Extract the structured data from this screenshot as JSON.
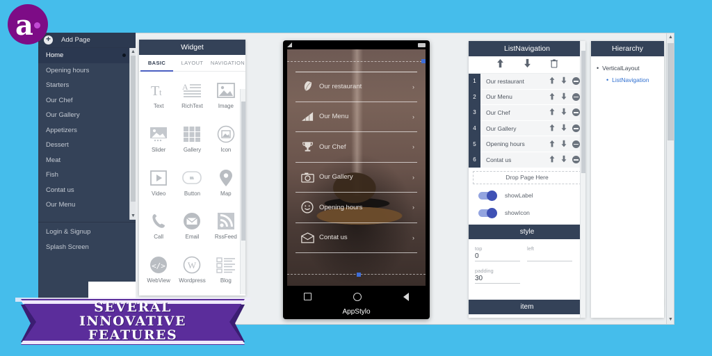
{
  "brand": {
    "logo_letter": "a",
    "logo_color": "#7d0c86"
  },
  "theme": {
    "background": "#45bdeb",
    "panel_header": "#344258",
    "sidebar": "#344258",
    "accent_blue": "#4662c6",
    "ribbon_purple": "#5b2d9b"
  },
  "sidebar": {
    "add_page_label": "Add Page",
    "items": [
      {
        "label": "Home",
        "active": true
      },
      {
        "label": "Opening hours",
        "active": false
      },
      {
        "label": "Starters",
        "active": false
      },
      {
        "label": "Our Chef",
        "active": false
      },
      {
        "label": "Our Gallery",
        "active": false
      },
      {
        "label": "Appetizers",
        "active": false
      },
      {
        "label": "Dessert",
        "active": false
      },
      {
        "label": "Meat",
        "active": false
      },
      {
        "label": "Fish",
        "active": false
      },
      {
        "label": "Contat us",
        "active": false
      },
      {
        "label": "Our Menu",
        "active": false
      }
    ],
    "footer_items": [
      {
        "label": "Login & Signup"
      },
      {
        "label": "Splash Screen"
      }
    ]
  },
  "widget_panel": {
    "title": "Widget",
    "tabs": [
      {
        "label": "BASIC",
        "active": true
      },
      {
        "label": "LAYOUT",
        "active": false
      },
      {
        "label": "NAVIGATION",
        "active": false
      }
    ],
    "widgets": [
      {
        "label": "Text",
        "icon": "text-icon"
      },
      {
        "label": "RichText",
        "icon": "richtext-icon"
      },
      {
        "label": "Image",
        "icon": "image-icon"
      },
      {
        "label": "Slider",
        "icon": "slider-icon"
      },
      {
        "label": "Gallery",
        "icon": "gallery-icon"
      },
      {
        "label": "Icon",
        "icon": "icon-icon"
      },
      {
        "label": "Video",
        "icon": "video-icon"
      },
      {
        "label": "Button",
        "icon": "button-icon"
      },
      {
        "label": "Map",
        "icon": "map-pin-icon"
      },
      {
        "label": "Call",
        "icon": "phone-icon"
      },
      {
        "label": "Email",
        "icon": "envelope-icon"
      },
      {
        "label": "RssFeed",
        "icon": "rss-icon"
      },
      {
        "label": "WebView",
        "icon": "code-icon"
      },
      {
        "label": "Wordpress",
        "icon": "wordpress-icon"
      },
      {
        "label": "Blog",
        "icon": "blog-icon"
      }
    ]
  },
  "phone": {
    "brand_label": "AppStylo",
    "rows": [
      {
        "label": "Our restaurant",
        "icon": "leaf-icon",
        "chevron": "›"
      },
      {
        "label": "Our Menu",
        "icon": "signal-bars-icon",
        "chevron": "›"
      },
      {
        "label": "Our Chef",
        "icon": "trophy-icon",
        "chevron": "›"
      },
      {
        "label": "Our Gallery",
        "icon": "camera-icon",
        "chevron": "›"
      },
      {
        "label": "Opening hours",
        "icon": "smiley-icon",
        "chevron": "›"
      },
      {
        "label": "Contat us",
        "icon": "mail-open-icon",
        "chevron": "›"
      }
    ]
  },
  "list_navigation": {
    "title": "ListNavigation",
    "toolbar": [
      {
        "icon": "move-up-icon"
      },
      {
        "icon": "move-down-icon"
      },
      {
        "icon": "trash-icon"
      }
    ],
    "rows": [
      {
        "num": "1",
        "label": "Our restaurant"
      },
      {
        "num": "2",
        "label": "Our Menu"
      },
      {
        "num": "3",
        "label": "Our Chef"
      },
      {
        "num": "4",
        "label": "Our Gallery"
      },
      {
        "num": "5",
        "label": "Opening hours"
      },
      {
        "num": "6",
        "label": "Contat us"
      }
    ],
    "dropzone_label": "Drop Page Here",
    "toggles": [
      {
        "label": "showLabel",
        "on": true
      },
      {
        "label": "showIcon",
        "on": true
      }
    ],
    "style_section": {
      "title": "style",
      "fields": [
        {
          "label": "top",
          "value": "0"
        },
        {
          "label": "left",
          "value": ""
        },
        {
          "label": "padding",
          "value": "30"
        }
      ]
    },
    "item_section": {
      "title": "item"
    }
  },
  "hierarchy": {
    "title": "Hierarchy",
    "root": "VerticalLayout",
    "child": "ListNavigation"
  },
  "fab": {
    "icon": "envelope-icon"
  },
  "ribbon": {
    "line1": "SEVERAL",
    "line2": "INNOVATIVE",
    "line3": "FEATURES"
  }
}
